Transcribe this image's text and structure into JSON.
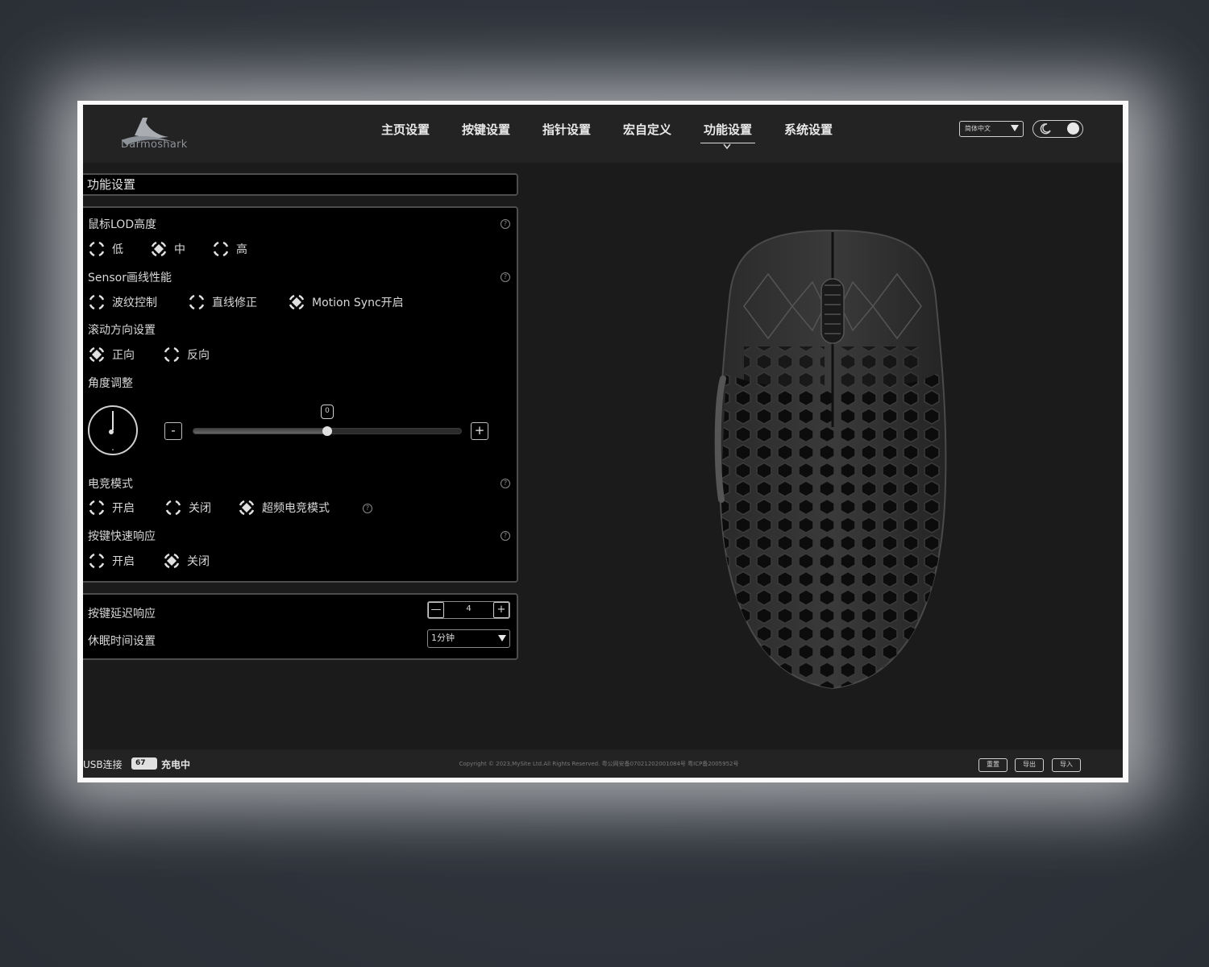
{
  "header": {
    "logo_text": "Darmoshark",
    "nav": [
      {
        "label": "主页设置",
        "active": false
      },
      {
        "label": "按键设置",
        "active": false
      },
      {
        "label": "指针设置",
        "active": false
      },
      {
        "label": "宏自定义",
        "active": false
      },
      {
        "label": "功能设置",
        "active": true
      },
      {
        "label": "系统设置",
        "active": false
      }
    ],
    "language": "简体中文",
    "theme_icons": [
      "moon-icon",
      "sun-icon"
    ]
  },
  "page": {
    "title": "功能设置",
    "lod": {
      "label": "鼠标LOD高度",
      "options": [
        "低",
        "中",
        "高"
      ],
      "selected": "中"
    },
    "sensor": {
      "label": "Sensor画线性能",
      "options": [
        "波纹控制",
        "直线修正",
        "Motion Sync开启"
      ],
      "selected": "Motion Sync开启"
    },
    "scroll": {
      "label": "滚动方向设置",
      "options": [
        "正向",
        "反向"
      ],
      "selected": "正向"
    },
    "angle": {
      "label": "角度调整",
      "value": "0",
      "fraction": 0.5,
      "minus": "-",
      "plus": "+"
    },
    "esports": {
      "label": "电竞模式",
      "options": [
        "开启",
        "关闭",
        "超频电竞模式"
      ],
      "selected": "超频电竞模式"
    },
    "fast_response": {
      "label": "按键快速响应",
      "options": [
        "开启",
        "关闭"
      ],
      "selected": "关闭"
    },
    "delay": {
      "label": "按键延迟响应",
      "value": "4",
      "minus": "—",
      "plus": "+"
    },
    "sleep": {
      "label": "休眠时间设置",
      "value": "1分钟"
    }
  },
  "footer": {
    "connection": "USB连接",
    "battery": "67",
    "status": "充电中",
    "copyright": "Copyright © 2023,MySite Ltd.All Rights Reserved. 粤公网安备07021202001084号 粤ICP备2005952号",
    "buttons": [
      "重置",
      "导出",
      "导入"
    ]
  },
  "colors": {
    "app_bg": "#1b1b1c",
    "header_bg": "#232324",
    "panel_bg": "#000000",
    "text": "#d8d8d8"
  }
}
